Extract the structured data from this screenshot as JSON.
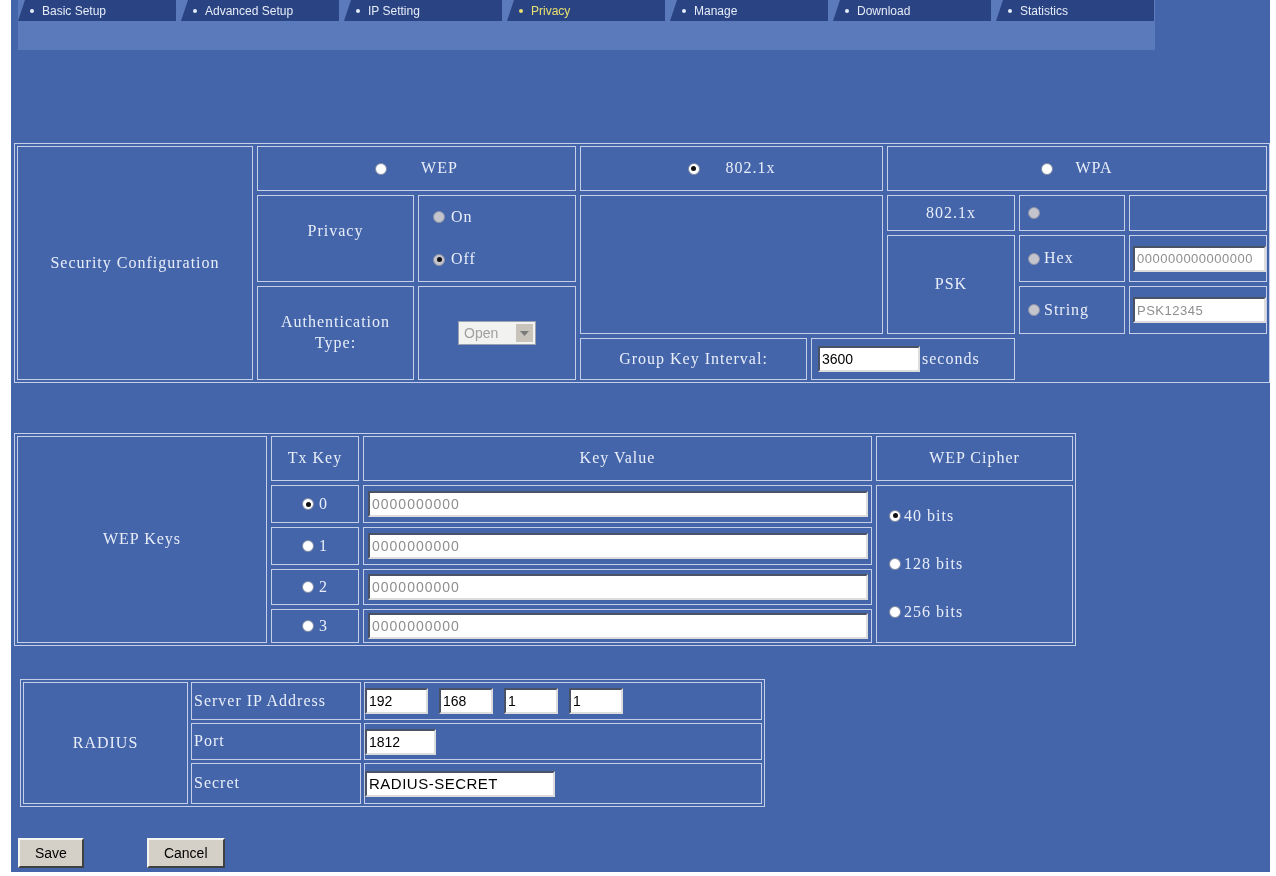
{
  "tabs": [
    {
      "label": "Basic Setup",
      "selected": false
    },
    {
      "label": "Advanced Setup",
      "selected": false
    },
    {
      "label": "IP Setting",
      "selected": false
    },
    {
      "label": "Privacy",
      "selected": true
    },
    {
      "label": "Manage",
      "selected": false
    },
    {
      "label": "Download",
      "selected": false
    },
    {
      "label": "Statistics",
      "selected": false
    }
  ],
  "security": {
    "label": "Security Configuration",
    "modes": [
      {
        "label": "WEP",
        "selected": false
      },
      {
        "label": "802.1x",
        "selected": true
      },
      {
        "label": "WPA",
        "selected": false
      }
    ],
    "wep": {
      "privacy_label": "Privacy",
      "privacy_options": [
        {
          "label": "On",
          "selected": false,
          "disabled": true
        },
        {
          "label": "Off",
          "selected": true,
          "disabled": true
        }
      ],
      "auth_label": "Authentication Type:",
      "auth_select": {
        "value": "Open",
        "disabled": true
      }
    },
    "group_key": {
      "label": "Group Key Interval:",
      "value": "3600",
      "unit": "seconds"
    },
    "wpa": {
      "dot1x_label": "802.1x",
      "dot1x_radio": {
        "selected": false,
        "disabled": true
      },
      "psk_label": "PSK",
      "psk_options": [
        {
          "label": "Hex",
          "selected": false,
          "disabled": true,
          "value": "000000000000000"
        },
        {
          "label": "String",
          "selected": false,
          "disabled": true,
          "value": "PSK12345"
        }
      ]
    }
  },
  "wep_keys": {
    "label": "WEP Keys",
    "columns": [
      "Tx Key",
      "Key Value",
      "WEP Cipher"
    ],
    "keys": [
      {
        "index": "0",
        "selected": true,
        "value": "0000000000",
        "disabled": true
      },
      {
        "index": "1",
        "selected": false,
        "value": "0000000000",
        "disabled": true
      },
      {
        "index": "2",
        "selected": false,
        "value": "0000000000",
        "disabled": true
      },
      {
        "index": "3",
        "selected": false,
        "value": "0000000000",
        "disabled": true
      }
    ],
    "ciphers": [
      {
        "label": "40 bits",
        "selected": true
      },
      {
        "label": "128 bits",
        "selected": false
      },
      {
        "label": "256 bits",
        "selected": false
      }
    ]
  },
  "radius": {
    "label": "RADIUS",
    "server_ip": {
      "label": "Server IP Address",
      "octets": [
        "192",
        "168",
        "1",
        "1"
      ]
    },
    "port": {
      "label": "Port",
      "value": "1812"
    },
    "secret": {
      "label": "Secret",
      "value": "RADIUS-SECRET"
    }
  },
  "buttons": [
    "Save",
    "Cancel"
  ]
}
